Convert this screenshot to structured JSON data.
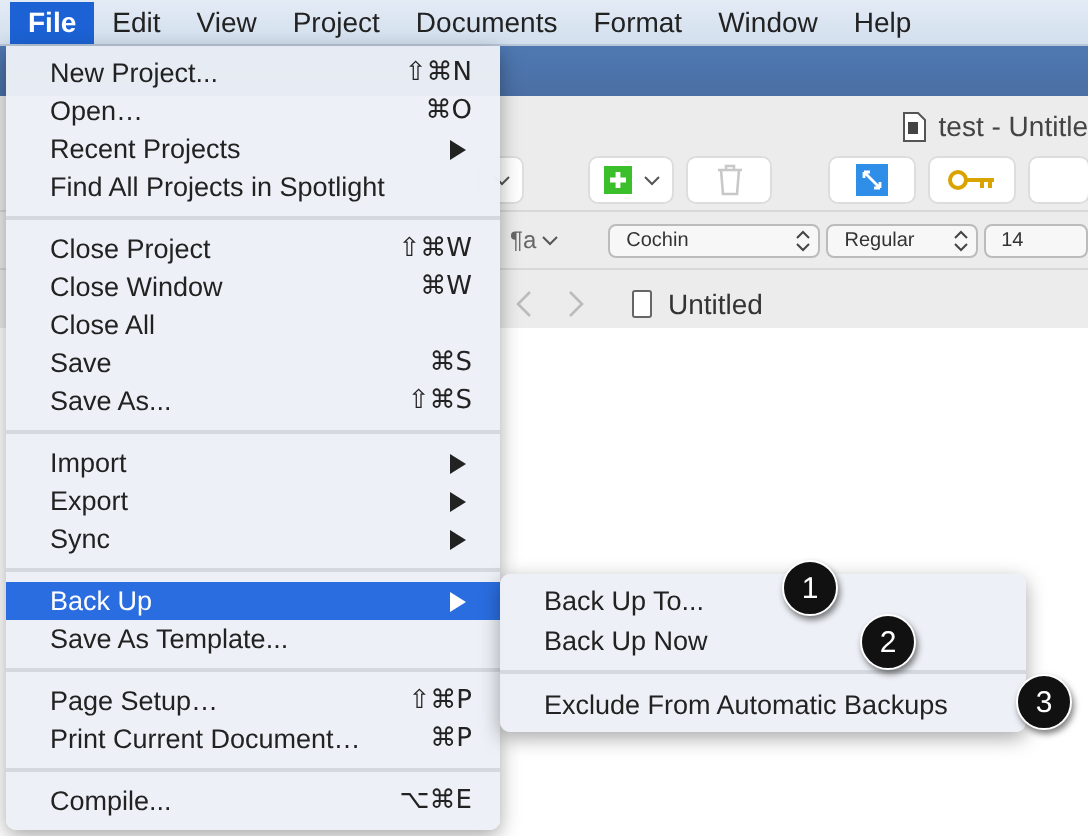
{
  "menu_bar": [
    {
      "label": "File",
      "selected": true
    },
    {
      "label": "Edit",
      "selected": false
    },
    {
      "label": "View",
      "selected": false
    },
    {
      "label": "Project",
      "selected": false
    },
    {
      "label": "Documents",
      "selected": false
    },
    {
      "label": "Format",
      "selected": false
    },
    {
      "label": "Window",
      "selected": false
    },
    {
      "label": "Help",
      "selected": false
    }
  ],
  "window": {
    "title": "test - Untitle"
  },
  "format_bar": {
    "paragraph_style": "¶a",
    "font": "Cochin",
    "style": "Regular",
    "size": "14"
  },
  "navigation": {
    "document": "Untitled"
  },
  "file_menu": {
    "sections": [
      [
        {
          "label": "New Project...",
          "shortcut": "⇧⌘N",
          "submenu": false,
          "selected": false
        },
        {
          "label": "Open…",
          "shortcut": "⌘O",
          "submenu": false,
          "selected": false
        },
        {
          "label": "Recent Projects",
          "submenu": true,
          "selected": false
        },
        {
          "label": "Find All Projects in Spotlight",
          "submenu": false,
          "selected": false
        }
      ],
      [
        {
          "label": "Close Project",
          "shortcut": "⇧⌘W",
          "submenu": false,
          "selected": false
        },
        {
          "label": "Close Window",
          "shortcut": "⌘W",
          "submenu": false,
          "selected": false
        },
        {
          "label": "Close All",
          "submenu": false,
          "selected": false
        },
        {
          "label": "Save",
          "shortcut": "⌘S",
          "submenu": false,
          "selected": false
        },
        {
          "label": "Save As...",
          "shortcut": "⇧⌘S",
          "submenu": false,
          "selected": false
        }
      ],
      [
        {
          "label": "Import",
          "submenu": true,
          "selected": false
        },
        {
          "label": "Export",
          "submenu": true,
          "selected": false
        },
        {
          "label": "Sync",
          "submenu": true,
          "selected": false
        }
      ],
      [
        {
          "label": "Back Up",
          "submenu": true,
          "selected": true
        },
        {
          "label": "Save As Template...",
          "submenu": false,
          "selected": false
        }
      ],
      [
        {
          "label": "Page Setup…",
          "shortcut": "⇧⌘P",
          "submenu": false,
          "selected": false
        },
        {
          "label": "Print Current Document…",
          "shortcut": "⌘P",
          "submenu": false,
          "selected": false
        }
      ],
      [
        {
          "label": "Compile...",
          "shortcut": "⌥⌘E",
          "submenu": false,
          "selected": false
        }
      ]
    ]
  },
  "back_up_submenu": {
    "sections": [
      [
        {
          "label": "Back Up To...",
          "badge": "1"
        },
        {
          "label": "Back Up Now",
          "badge": "2"
        }
      ],
      [
        {
          "label": "Exclude From Automatic Backups",
          "badge": "3"
        }
      ]
    ]
  }
}
